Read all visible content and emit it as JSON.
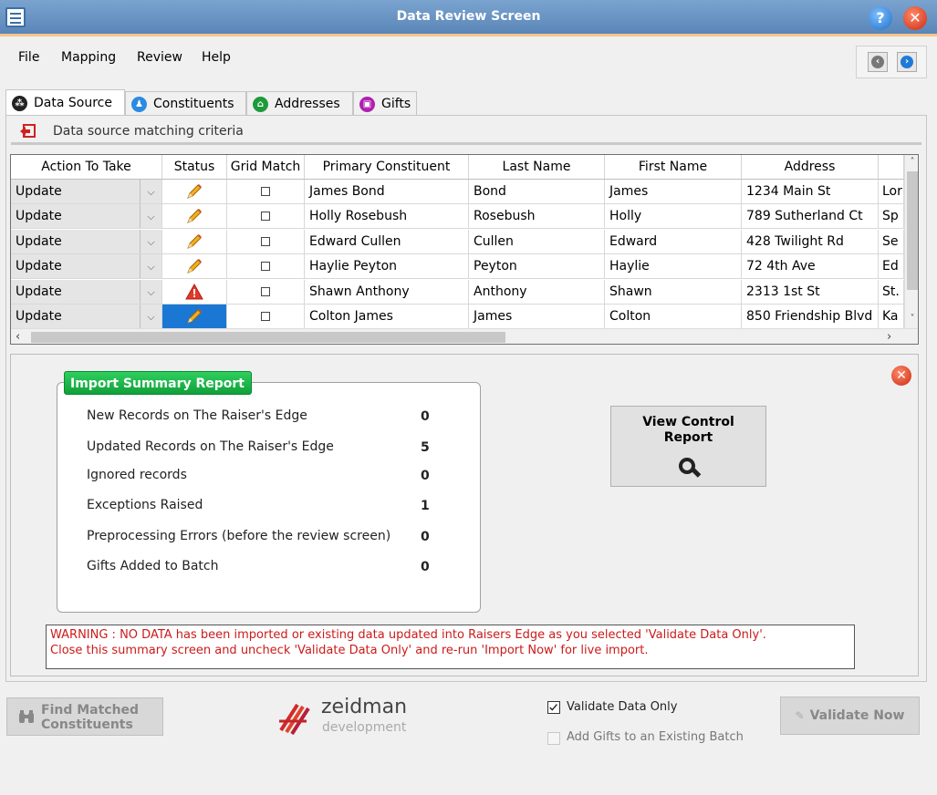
{
  "window": {
    "title": "Data Review Screen"
  },
  "menu": [
    "File",
    "Mapping",
    "Review",
    "Help"
  ],
  "tabs": [
    {
      "label": "Data Source",
      "icon": "database-icon",
      "color": "#222222"
    },
    {
      "label": "Constituents",
      "icon": "people-icon",
      "color": "#2a8be0"
    },
    {
      "label": "Addresses",
      "icon": "home-icon",
      "color": "#1e9a3a"
    },
    {
      "label": "Gifts",
      "icon": "gift-icon",
      "color": "#b01fb0"
    }
  ],
  "criteria_label": "Data source matching criteria",
  "grid": {
    "columns": [
      "Action To Take",
      "Status",
      "Grid Match",
      "Primary Constituent",
      "Last Name",
      "First Name",
      "Address",
      ""
    ],
    "rows": [
      {
        "action": "Update",
        "status": "edit",
        "primary": "James Bond",
        "last": "Bond",
        "first": "James",
        "address": "1234 Main St",
        "city": "Lor"
      },
      {
        "action": "Update",
        "status": "edit",
        "primary": "Holly Rosebush",
        "last": "Rosebush",
        "first": "Holly",
        "address": "789 Sutherland Ct",
        "city": "Sp"
      },
      {
        "action": "Update",
        "status": "edit",
        "primary": "Edward Cullen",
        "last": "Cullen",
        "first": "Edward",
        "address": "428 Twilight Rd",
        "city": "Se"
      },
      {
        "action": "Update",
        "status": "edit",
        "primary": "Haylie Peyton",
        "last": "Peyton",
        "first": "Haylie",
        "address": "72 4th Ave",
        "city": "Ed"
      },
      {
        "action": "Update",
        "status": "warning",
        "primary": "Shawn Anthony",
        "last": "Anthony",
        "first": "Shawn",
        "address": "2313 1st St",
        "city": "St."
      },
      {
        "action": "Update",
        "status": "edit-selected",
        "primary": "Colton James",
        "last": "James",
        "first": "Colton",
        "address": "850 Friendship Blvd",
        "city": "Ka"
      }
    ]
  },
  "summary": {
    "title": "Import Summary Report",
    "rows": [
      {
        "label": "New Records on The Raiser's Edge",
        "value": "0"
      },
      {
        "label": "Updated Records on The Raiser's Edge",
        "value": "5"
      },
      {
        "label": "Ignored records",
        "value": "0"
      },
      {
        "label": "Exceptions Raised",
        "value": "1"
      },
      {
        "label": "Preprocessing Errors (before the review screen)",
        "value": "0"
      },
      {
        "label": "Gifts Added to Batch",
        "value": "0"
      }
    ]
  },
  "view_control_report": "View Control Report",
  "warning_line1": "WARNING : NO DATA has been imported or existing data updated into Raisers Edge as you selected 'Validate Data Only'.",
  "warning_line2": "Close this summary screen and uncheck 'Validate Data Only' and re-run 'Import Now' for live import.",
  "find_button": {
    "line1": "Find Matched",
    "line2": "Constituents"
  },
  "logo": {
    "name": "zeidman",
    "sub": "development"
  },
  "validate_only": {
    "label": "Validate Data Only",
    "checked": true
  },
  "add_gifts": {
    "label": "Add Gifts to an Existing Batch",
    "checked": false
  },
  "validate_button": "Validate Now",
  "colors": {
    "title_bar": "#5a86b8",
    "selection": "#1a78d4",
    "summary_green": "#10a03a",
    "warning_red": "#cc1a1a"
  }
}
